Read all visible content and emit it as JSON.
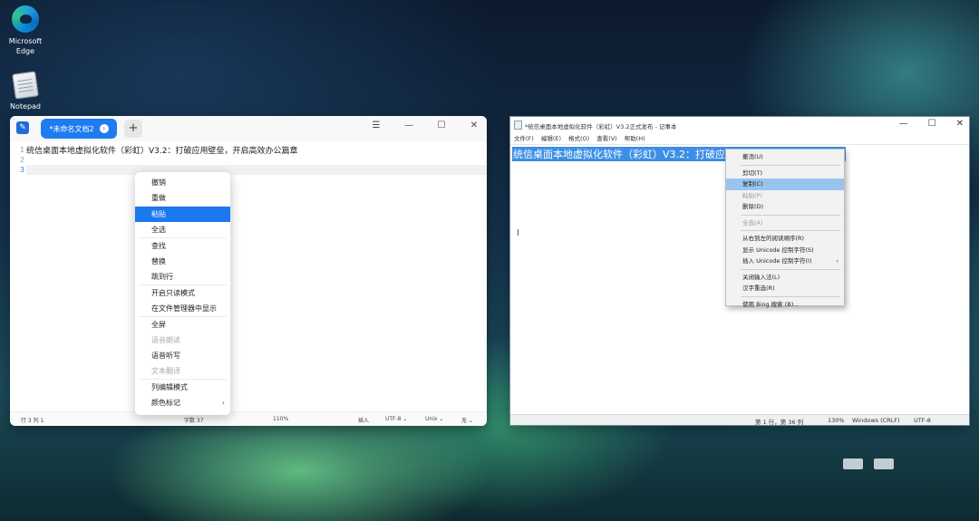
{
  "desktop": {
    "icons": [
      {
        "label_line1": "Microsoft",
        "label_line2": "Edge"
      },
      {
        "label_line1": "Notepad"
      }
    ]
  },
  "left_window": {
    "tab_title": "*未命名文档2",
    "new_tab": "+",
    "window_buttons": [
      "☰",
      "—",
      "☐",
      "✕"
    ],
    "line_numbers": [
      "1",
      "2",
      "3"
    ],
    "line1_text": "统信桌面本地虚拟化软件（彩虹）V3.2：打破应用壁垒，开启高效办公篇章",
    "status": {
      "position": "行 3  列 1",
      "chars": "字数 37",
      "zoom": "110%",
      "insert": "插入",
      "encoding": "UTF-8 ⌄",
      "line_ending": "Unix ⌄",
      "highlight": "无 ⌄"
    },
    "context_menu": {
      "items": [
        {
          "label": "撤销"
        },
        {
          "label": "重做"
        },
        {
          "label": "粘贴",
          "selected": true
        },
        {
          "label": "全选"
        },
        {
          "label": "查找"
        },
        {
          "label": "替换"
        },
        {
          "label": "跳到行"
        },
        {
          "label": "开启只读模式"
        },
        {
          "label": "在文件管理器中显示"
        },
        {
          "label": "全屏"
        },
        {
          "label": "语音朗读",
          "disabled": true
        },
        {
          "label": "语音听写"
        },
        {
          "label": "文本翻译",
          "disabled": true
        },
        {
          "label": "列编辑模式"
        },
        {
          "label": "颜色标记",
          "submenu": true
        }
      ]
    }
  },
  "right_window": {
    "title": "*统信桌面本地虚拟化软件（彩虹）V3.2正式发布 - 记事本",
    "window_buttons": [
      "—",
      "☐",
      "✕"
    ],
    "menu": [
      "文件(F)",
      "编辑(E)",
      "格式(O)",
      "查看(V)",
      "帮助(H)"
    ],
    "selected_text": "统信桌面本地虚拟化软件（彩虹）V3.2：打破应用壁垒，开启高效办公篇章",
    "cursor": "I",
    "status": {
      "position": "第 1 行，第 36 列",
      "zoom": "130%",
      "line_ending": "Windows (CRLF)",
      "encoding": "UTF-8"
    },
    "context_menu": {
      "items": [
        {
          "label": "撤消(U)"
        },
        {
          "label": "剪切(T)"
        },
        {
          "label": "复制(C)",
          "selected": true
        },
        {
          "label": "粘贴(P)",
          "disabled": true
        },
        {
          "label": "删除(D)"
        },
        {
          "label": "全选(A)",
          "disabled": true
        },
        {
          "label": "从右到左的阅读顺序(R)"
        },
        {
          "label": "显示 Unicode 控制字符(S)"
        },
        {
          "label": "插入 Unicode 控制字符(I)",
          "submenu": true
        },
        {
          "label": "关闭输入法(L)"
        },
        {
          "label": "汉字重选(R)"
        },
        {
          "label": "使用 Bing 搜索 (B)..."
        }
      ]
    }
  }
}
